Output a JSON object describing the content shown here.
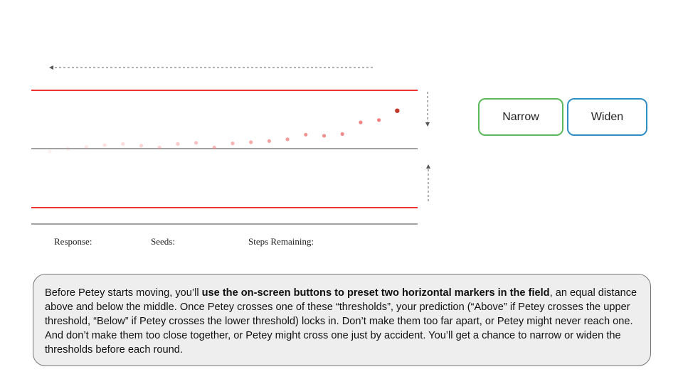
{
  "buttons": {
    "narrow_label": "Narrow",
    "widen_label": "Widen"
  },
  "status": {
    "response_label": "Response:",
    "seeds_label": "Seeds:",
    "steps_remaining_label": "Steps Remaining:"
  },
  "instructions": {
    "part1": "Before Petey starts moving, you’ll ",
    "bold": "use the on-screen buttons to preset two horizontal markers in the field",
    "part2": ", an equal distance above and below the middle. Once Petey crosses one of these “thresholds”, your prediction (“Above” if Petey crosses the upper threshold, “Below” if Petey crosses the lower threshold) locks in. Don’t make them too far apart, or Petey might never reach one. And don’t make them too close together, or Petey might cross one just by accident. You’ll get a chance to narrow or widen the thresholds before each round."
  },
  "colors": {
    "threshold": "#ee3333",
    "narrow_border": "#5cb85c",
    "widen_border": "#2f8fc4",
    "petey": "#c0392b",
    "trail": "#f08080"
  },
  "trail_points": [
    {
      "step": 1,
      "offset": -0.05,
      "opacity": 0.12
    },
    {
      "step": 2,
      "offset": 0.0,
      "opacity": 0.16
    },
    {
      "step": 3,
      "offset": 0.03,
      "opacity": 0.2
    },
    {
      "step": 4,
      "offset": 0.06,
      "opacity": 0.24
    },
    {
      "step": 5,
      "offset": 0.08,
      "opacity": 0.28
    },
    {
      "step": 6,
      "offset": 0.05,
      "opacity": 0.32
    },
    {
      "step": 7,
      "offset": 0.02,
      "opacity": 0.36
    },
    {
      "step": 8,
      "offset": 0.08,
      "opacity": 0.42
    },
    {
      "step": 9,
      "offset": 0.1,
      "opacity": 0.48
    },
    {
      "step": 10,
      "offset": 0.02,
      "opacity": 0.54
    },
    {
      "step": 11,
      "offset": 0.09,
      "opacity": 0.6
    },
    {
      "step": 12,
      "offset": 0.11,
      "opacity": 0.66
    },
    {
      "step": 13,
      "offset": 0.13,
      "opacity": 0.72
    },
    {
      "step": 14,
      "offset": 0.16,
      "opacity": 0.78
    },
    {
      "step": 15,
      "offset": 0.24,
      "opacity": 0.84
    },
    {
      "step": 16,
      "offset": 0.22,
      "opacity": 0.88
    },
    {
      "step": 17,
      "offset": 0.25,
      "opacity": 0.92
    },
    {
      "step": 18,
      "offset": 0.45,
      "opacity": 0.96
    },
    {
      "step": 19,
      "offset": 0.49,
      "opacity": 1.0
    }
  ],
  "petey_point": {
    "step": 20,
    "offset": 0.65
  }
}
